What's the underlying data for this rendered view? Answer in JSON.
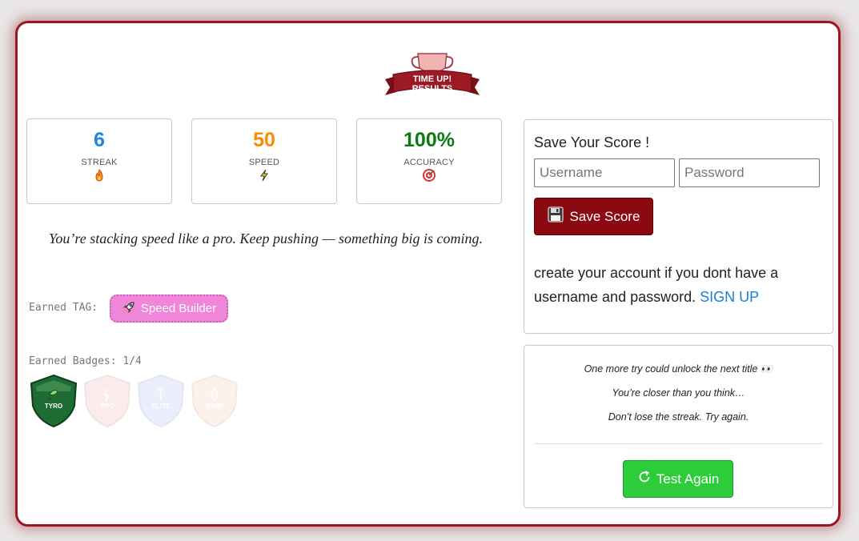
{
  "logo": {
    "line1": "TIME UP!",
    "line2": "RESULTS"
  },
  "stats": [
    {
      "value": "6",
      "label": "STREAK",
      "color": "#1f86e0",
      "icon": "fire-icon"
    },
    {
      "value": "50",
      "label": "SPEED",
      "color": "#ff8a00",
      "icon": "lightning-icon"
    },
    {
      "value": "100%",
      "label": "ACCURACY",
      "color": "#0b7a12",
      "icon": "target-icon"
    }
  ],
  "motto": "You’re stacking speed like a pro. Keep pushing — something big is coming.",
  "tag": {
    "label": "Earned TAG:",
    "name": "Speed Builder",
    "icon": "rocket-icon",
    "color": "#ef86d9"
  },
  "badges": {
    "label": "Earned Badges: 1/4",
    "items": [
      {
        "name": "TYRO",
        "earned": true,
        "color": "#1f6b34"
      },
      {
        "name": "PRO",
        "earned": false,
        "color": "#e88a8a"
      },
      {
        "name": "ELITE",
        "earned": false,
        "color": "#8aa0e8"
      },
      {
        "name": "KING",
        "earned": false,
        "color": "#f0b48a"
      }
    ]
  },
  "save": {
    "title": "Save Your Score !",
    "username_placeholder": "Username",
    "password_placeholder": "Password",
    "button_label": "Save Score",
    "button_icon": "floppy-disk-icon",
    "account_text": "create your account if you dont have a username and password.",
    "signup_label": "SIGN UP"
  },
  "encourage": {
    "lines": [
      "One more try could unlock the next title",
      "You’re closer than you think…",
      "Don’t lose the streak. Try again."
    ],
    "eyes_emoji": "👀",
    "button_label": "Test Again",
    "button_icon": "reload-icon"
  }
}
